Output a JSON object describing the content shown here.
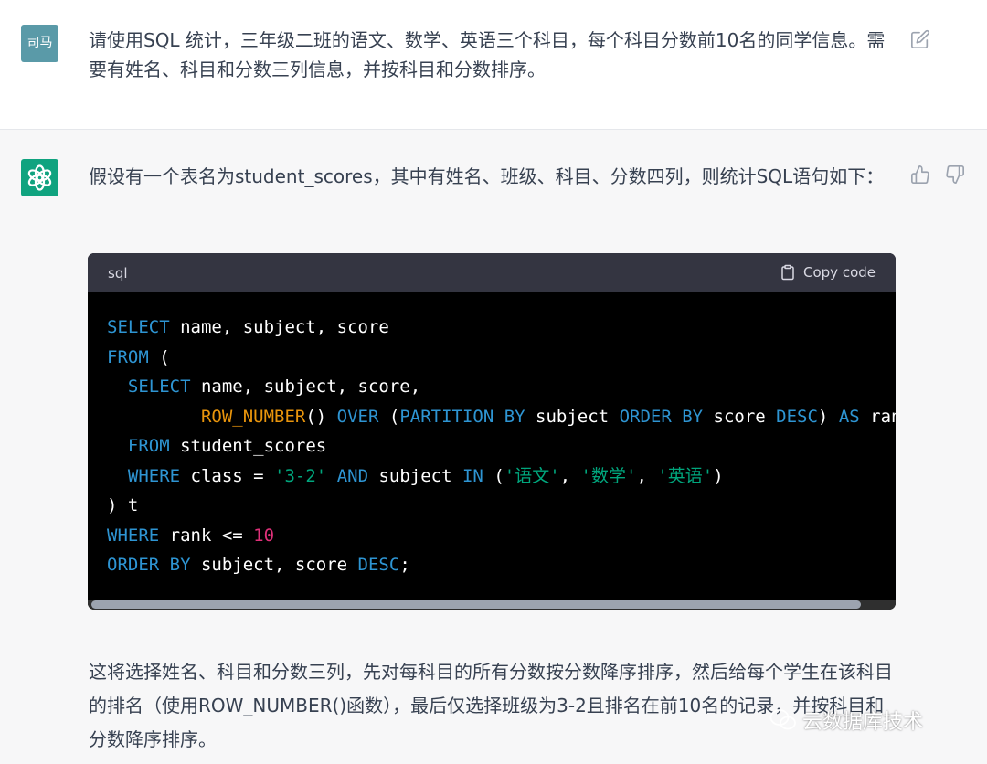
{
  "user": {
    "avatar_text": "司马",
    "message": "请使用SQL 统计，三年级二班的语文、数学、英语三个科目，每个科目分数前10名的同学信息。需要有姓名、科目和分数三列信息，并按科目和分数排序。"
  },
  "assistant": {
    "intro": "假设有一个表名为student_scores，其中有姓名、班级、科目、分数四列，则统计SQL语句如下：",
    "code_lang": "sql",
    "copy_label": "Copy code",
    "explanation": "这将选择姓名、科目和分数三列，先对每科目的所有分数按分数降序排序，然后给每个学生在该科目的排名（使用ROW_NUMBER()函数），最后仅选择班级为3-2且排名在前10名的记录，并按科目和分数降序排序。"
  },
  "code_lines": [
    [
      {
        "t": "kw",
        "v": "SELECT"
      },
      {
        "t": "p",
        "v": " name, subject, score"
      }
    ],
    [
      {
        "t": "kw",
        "v": "FROM"
      },
      {
        "t": "p",
        "v": " ("
      }
    ],
    [
      {
        "t": "p",
        "v": "  "
      },
      {
        "t": "kw",
        "v": "SELECT"
      },
      {
        "t": "p",
        "v": " name, subject, score,"
      }
    ],
    [
      {
        "t": "p",
        "v": "         "
      },
      {
        "t": "fn2",
        "v": "ROW_NUMBER"
      },
      {
        "t": "p",
        "v": "() "
      },
      {
        "t": "kw",
        "v": "OVER"
      },
      {
        "t": "p",
        "v": " ("
      },
      {
        "t": "kw",
        "v": "PARTITION BY"
      },
      {
        "t": "p",
        "v": " subject "
      },
      {
        "t": "kw",
        "v": "ORDER BY"
      },
      {
        "t": "p",
        "v": " score "
      },
      {
        "t": "kw",
        "v": "DESC"
      },
      {
        "t": "p",
        "v": ") "
      },
      {
        "t": "kw",
        "v": "AS"
      },
      {
        "t": "p",
        "v": " rank"
      }
    ],
    [
      {
        "t": "p",
        "v": "  "
      },
      {
        "t": "kw",
        "v": "FROM"
      },
      {
        "t": "p",
        "v": " student_scores"
      }
    ],
    [
      {
        "t": "p",
        "v": "  "
      },
      {
        "t": "kw",
        "v": "WHERE"
      },
      {
        "t": "p",
        "v": " class = "
      },
      {
        "t": "str",
        "v": "'3-2'"
      },
      {
        "t": "p",
        "v": " "
      },
      {
        "t": "kw",
        "v": "AND"
      },
      {
        "t": "p",
        "v": " subject "
      },
      {
        "t": "kw",
        "v": "IN"
      },
      {
        "t": "p",
        "v": " ("
      },
      {
        "t": "str",
        "v": "'语文'"
      },
      {
        "t": "p",
        "v": ", "
      },
      {
        "t": "str",
        "v": "'数学'"
      },
      {
        "t": "p",
        "v": ", "
      },
      {
        "t": "str",
        "v": "'英语'"
      },
      {
        "t": "p",
        "v": ")"
      }
    ],
    [
      {
        "t": "p",
        "v": ") t"
      }
    ],
    [
      {
        "t": "kw",
        "v": "WHERE"
      },
      {
        "t": "p",
        "v": " rank <= "
      },
      {
        "t": "num",
        "v": "10"
      }
    ],
    [
      {
        "t": "kw",
        "v": "ORDER BY"
      },
      {
        "t": "p",
        "v": " subject, score "
      },
      {
        "t": "kw",
        "v": "DESC"
      },
      {
        "t": "p",
        "v": ";"
      }
    ]
  ],
  "watermark": "云数据库技术",
  "icons": {
    "edit": "edit-icon",
    "thumbs_up": "thumbs-up-icon",
    "thumbs_down": "thumbs-down-icon",
    "copy": "clipboard-icon",
    "ai_logo": "openai-logo-icon",
    "wechat": "wechat-icon"
  },
  "colors": {
    "keyword": "#2e95d3",
    "function": "#e9950c",
    "string": "#00a67d",
    "number": "#df3079",
    "ai_avatar": "#10a37f",
    "user_avatar": "#5a9aa8"
  }
}
